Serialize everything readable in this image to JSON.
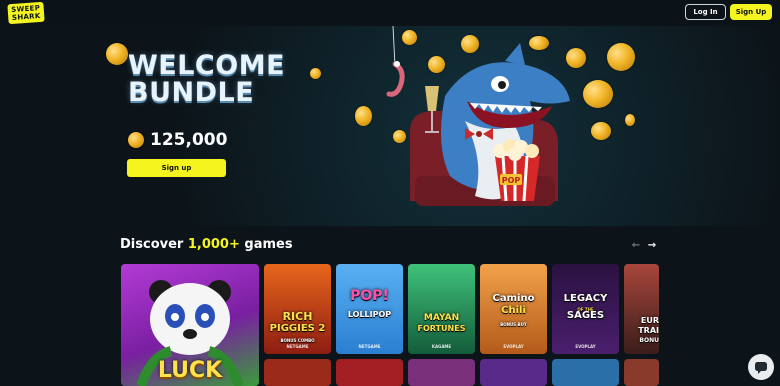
{
  "header": {
    "logo_line1": "SWEEP",
    "logo_line2": "SHARK",
    "login_label": "Log In",
    "signup_label": "Sign Up"
  },
  "hero": {
    "title_line1": "WELCOME",
    "title_line2": "BUNDLE",
    "amount": "125,000",
    "signup_label": "Sign up",
    "popcorn_label": "POP"
  },
  "games_section": {
    "title_prefix": "Discover ",
    "title_highlight": "1,000+",
    "title_suffix": " games",
    "prev_icon": "chevron-left-icon",
    "next_icon": "chevron-right-icon",
    "featured": {
      "title": "LUCK"
    },
    "cards": [
      {
        "title_line1": "RICH",
        "title_line2": "PIGGIES 2",
        "badge": "BONUS COMBO",
        "provider": "NETGAME",
        "bg": "#8e1d12"
      },
      {
        "title_line1": "POP!",
        "title_line2": "LOLLIPOP",
        "badge": "",
        "provider": "NETGAME",
        "bg": "#2a7fd1"
      },
      {
        "title_line1": "MAYAN",
        "title_line2": "FORTUNES",
        "badge": "",
        "provider": "KAGAME",
        "bg": "#1f8c5a"
      },
      {
        "title_line1": "Camino",
        "title_line2": "Chili",
        "badge": "BONUS BUY",
        "provider": "EVOPLAY",
        "bg": "#b35a1a"
      },
      {
        "title_line1": "LEGACY",
        "title_line2": "SAGES",
        "badge": "OF THE",
        "provider": "EVOPLAY",
        "bg": "#4a1f6e"
      },
      {
        "title_line1": "EUR",
        "title_line2": "TRAI",
        "badge": "BONU",
        "provider": "",
        "bg": "#5b2d28"
      }
    ]
  },
  "colors": {
    "accent": "#f4f51f",
    "background": "#0c1419"
  },
  "chat": {
    "icon": "chat-icon"
  }
}
